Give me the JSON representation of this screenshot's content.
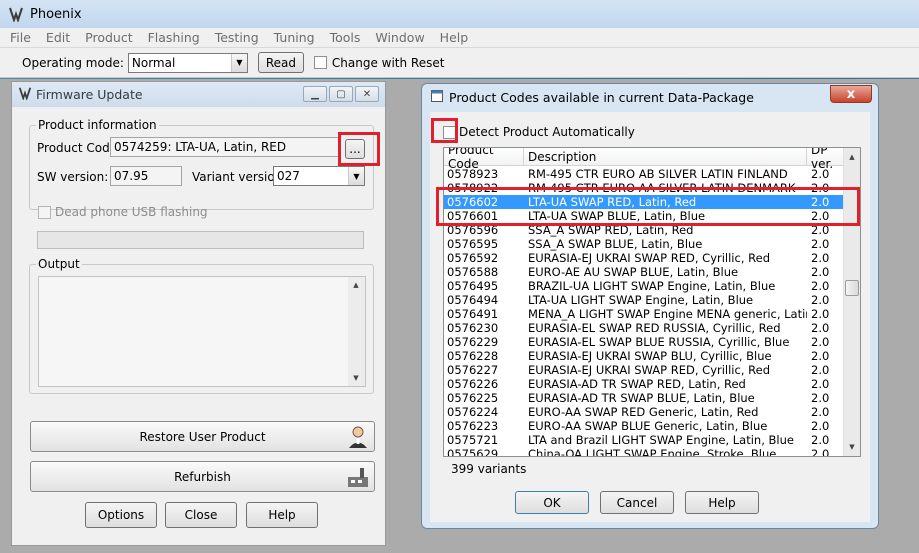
{
  "app": {
    "title": "Phoenix"
  },
  "menu": [
    "File",
    "Edit",
    "Product",
    "Flashing",
    "Testing",
    "Tuning",
    "Tools",
    "Window",
    "Help"
  ],
  "toolbar": {
    "operating_mode_label": "Operating mode:",
    "operating_mode_value": "Normal",
    "read_label": "Read",
    "change_with_reset_label": "Change with Reset"
  },
  "firmware": {
    "title": "Firmware Update",
    "product_info_label": "Product information",
    "product_code_label": "Product Code:",
    "product_code_value": "0574259: LTA-UA, Latin, RED",
    "browse_label": "...",
    "sw_version_label": "SW version:",
    "sw_version_value": "07.95",
    "variant_version_label": "Variant version:",
    "variant_version_value": "027",
    "dead_phone_label": "Dead phone USB flashing",
    "output_label": "Output",
    "restore_label": "Restore User Product",
    "refurbish_label": "Refurbish",
    "options_label": "Options",
    "close_label": "Close",
    "help_label": "Help"
  },
  "dialog": {
    "title": "Product Codes available in current Data-Package",
    "close_glyph": "x",
    "detect_label": "Detect Product Automatically",
    "columns": [
      "Product Code",
      "Description",
      "DP ver."
    ],
    "rows": [
      [
        "0578923",
        "RM-495 CTR EURO AB SILVER LATIN FINLAND",
        "2.0"
      ],
      [
        "0578922",
        "RM-495 CTR EURO AA SILVER LATIN DENMARK",
        "2.0"
      ],
      [
        "0576602",
        "LTA-UA SWAP RED, Latin, Red",
        "2.0"
      ],
      [
        "0576601",
        "LTA-UA SWAP BLUE, Latin, Blue",
        "2.0"
      ],
      [
        "0576596",
        "SSA_A SWAP RED, Latin, Red",
        "2.0"
      ],
      [
        "0576595",
        "SSA_A SWAP BLUE, Latin, Blue",
        "2.0"
      ],
      [
        "0576592",
        "EURASIA-EJ UKRAI SWAP RED, Cyrillic, Red",
        "2.0"
      ],
      [
        "0576588",
        "EURO-AE AU SWAP BLUE, Latin, Blue",
        "2.0"
      ],
      [
        "0576495",
        "BRAZIL-UA LIGHT SWAP Engine, Latin, Blue",
        "2.0"
      ],
      [
        "0576494",
        "LTA-UA LIGHT SWAP Engine, Latin, Blue",
        "2.0"
      ],
      [
        "0576491",
        "MENA_A LIGHT SWAP Engine MENA generic, Latin, Blue",
        "2.0"
      ],
      [
        "0576230",
        "EURASIA-EL SWAP RED RUSSIA, Cyrillic, Red",
        "2.0"
      ],
      [
        "0576229",
        "EURASIA-EL SWAP BLUE RUSSIA, Cyrillic, Blue",
        "2.0"
      ],
      [
        "0576228",
        "EURASIA-EJ UKRAI SWAP BLU, Cyrillic, Blue",
        "2.0"
      ],
      [
        "0576227",
        "EURASIA-EJ UKRAI SWAP RED, Cyrillic, Red",
        "2.0"
      ],
      [
        "0576226",
        "EURASIA-AD TR SWAP RED, Latin, Red",
        "2.0"
      ],
      [
        "0576225",
        "EURASIA-AD TR SWAP BLUE, Latin, Blue",
        "2.0"
      ],
      [
        "0576224",
        "EURO-AA SWAP RED Generic, Latin, Red",
        "2.0"
      ],
      [
        "0576223",
        "EURO-AA SWAP BLUE Generic, Latin, Blue",
        "2.0"
      ],
      [
        "0575721",
        "LTA and Brazil LIGHT SWAP Engine, Latin, Blue",
        "2.0"
      ],
      [
        "0575629",
        "China-OA LIGHT SWAP Engine, Stroke, Blue",
        "2.0"
      ]
    ],
    "selected_row": 2,
    "count_text": "399 variants",
    "ok_label": "OK",
    "cancel_label": "Cancel",
    "help_label": "Help"
  },
  "colors": {
    "selection": "#3399ff",
    "highlight": "#e0202c"
  }
}
